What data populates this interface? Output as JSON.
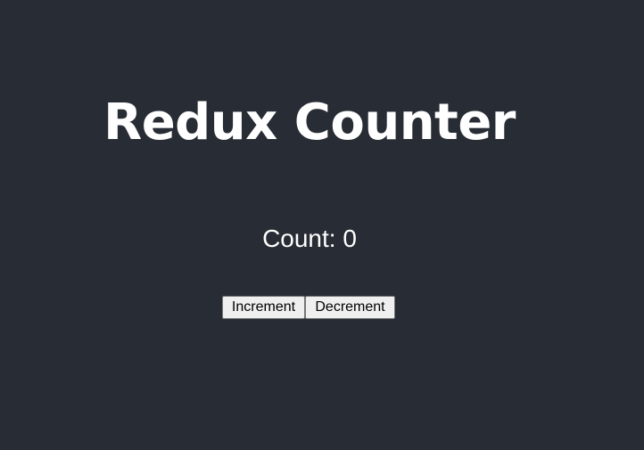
{
  "app": {
    "title": "Redux Counter",
    "count_label": "Count:",
    "count_value": "0"
  },
  "buttons": {
    "increment_label": "Increment",
    "decrement_label": "Decrement"
  },
  "colors": {
    "background": "#282c34",
    "text": "#ffffff",
    "button_bg": "#efefef",
    "button_border": "#767676"
  }
}
